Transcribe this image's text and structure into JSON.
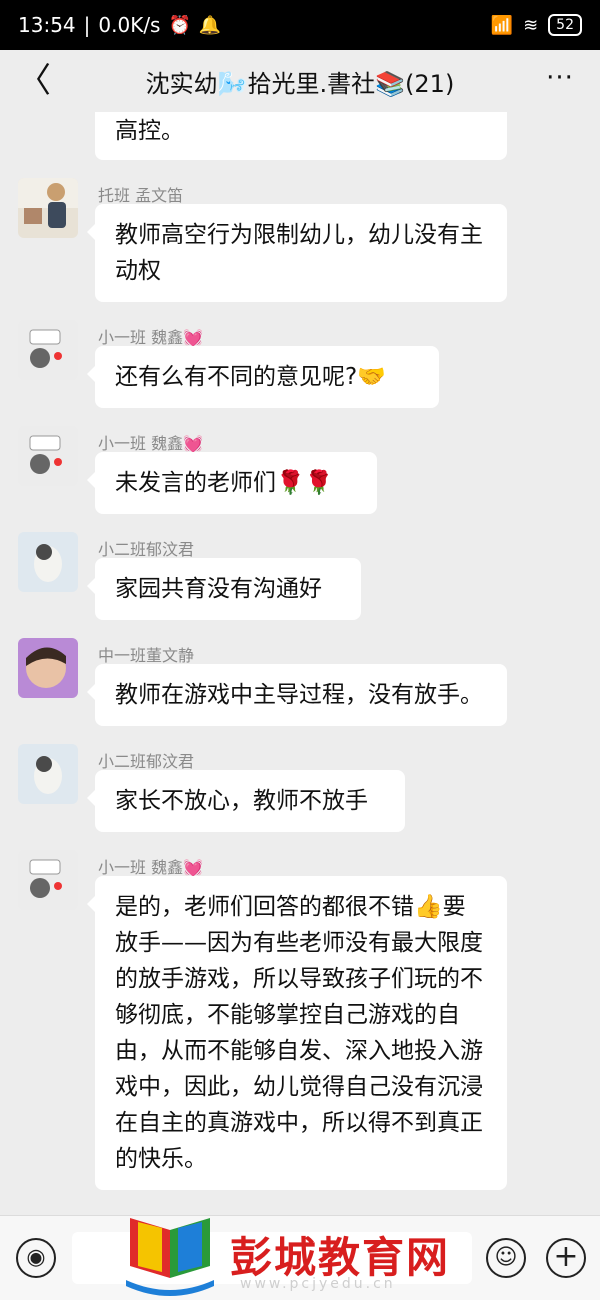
{
  "status_bar": {
    "time": "13:54",
    "speed": "0.0K/s",
    "battery": "52"
  },
  "header": {
    "title": "沈实幼🌬️拾光里.書社📚(21)",
    "back_symbol": "〈",
    "more_symbol": "···"
  },
  "messages": [
    {
      "sender": "",
      "text": "高控。"
    },
    {
      "sender": "托班 孟文笛",
      "text": "教师高空行为限制幼儿，幼儿没有主动权"
    },
    {
      "sender": "小一班 魏鑫💓",
      "text": "还有么有不同的意见呢?🤝"
    },
    {
      "sender": "小一班 魏鑫💓",
      "text": "未发言的老师们🌹🌹"
    },
    {
      "sender": "小二班郁汶君",
      "text": "家园共育没有沟通好"
    },
    {
      "sender": "中一班董文静",
      "text": "教师在游戏中主导过程，没有放手。"
    },
    {
      "sender": "小二班郁汶君",
      "text": "家长不放心，教师不放手"
    },
    {
      "sender": "小一班 魏鑫💓",
      "text": "是的，老师们回答的都很不错👍要放手——因为有些老师没有最大限度的放手游戏，所以导致孩子们玩的不够彻底，不能够掌控自己游戏的自由，从而不能够自发、深入地投入游戏中，因此，幼儿觉得自己没有沉浸在自主的真游戏中，所以得不到真正的快乐。"
    }
  ],
  "bottom_bar": {
    "voice_symbol": "◉",
    "emoji_symbol": "☺",
    "plus_symbol": "+"
  },
  "watermark": {
    "name": "彭城教育网",
    "url": "www.pcjyedu.cn"
  },
  "icons": {
    "status": [
      "alarm-icon",
      "notification-icon",
      "signal-icon",
      "wifi-icon",
      "battery-icon"
    ],
    "header": [
      "back-icon",
      "more-icon"
    ],
    "bottom": [
      "voice-icon",
      "emoji-icon",
      "plus-icon"
    ]
  }
}
